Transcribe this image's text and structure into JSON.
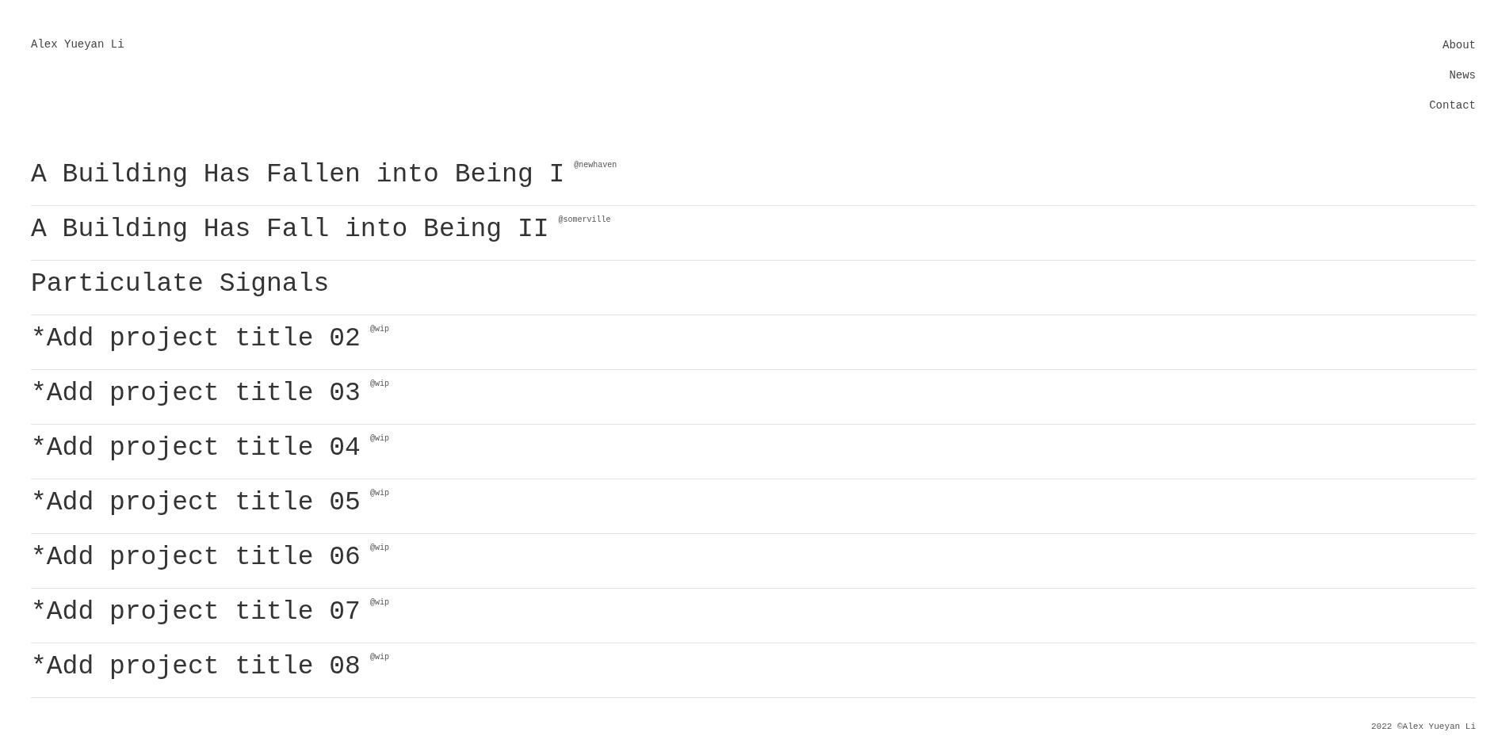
{
  "site_name": "Alex Yueyan Li",
  "nav": [
    {
      "label": "About"
    },
    {
      "label": "News"
    },
    {
      "label": "Contact"
    }
  ],
  "projects": [
    {
      "title": "A Building Has Fallen into Being I",
      "tag": "@newhaven"
    },
    {
      "title": "A Building Has Fall into Being II",
      "tag": "@somerville"
    },
    {
      "title": "Particulate Signals"
    },
    {
      "title": "*Add project title 02",
      "tag": "@wip"
    },
    {
      "title": "*Add project title 03",
      "tag": "@wip"
    },
    {
      "title": "*Add project title 04",
      "tag": "@wip"
    },
    {
      "title": "*Add project title 05",
      "tag": "@wip"
    },
    {
      "title": "*Add project title 06",
      "tag": "@wip"
    },
    {
      "title": "*Add project title 07",
      "tag": "@wip"
    },
    {
      "title": "*Add project title 08",
      "tag": "@wip"
    }
  ],
  "footer": "2022 ©Alex Yueyan Li"
}
